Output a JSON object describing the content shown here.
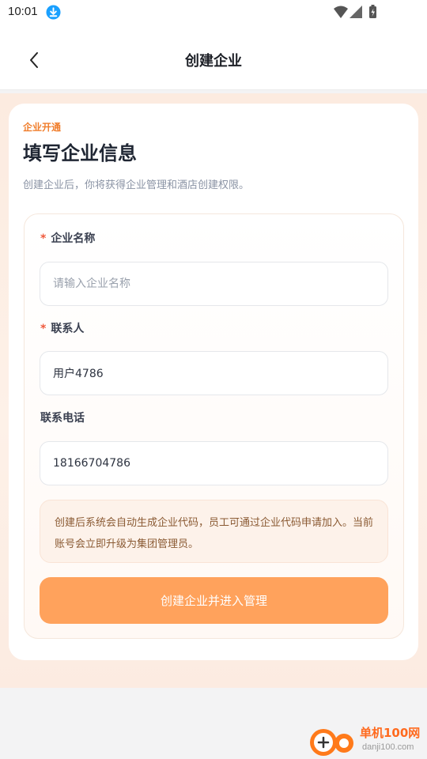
{
  "status_bar": {
    "time": "10:01"
  },
  "header": {
    "title": "创建企业"
  },
  "intro": {
    "kicker": "企业开通",
    "title": "填写企业信息",
    "subtitle": "创建企业后，你将获得企业管理和酒店创建权限。"
  },
  "form": {
    "company_name": {
      "label": "企业名称",
      "required_mark": "*",
      "value": "",
      "placeholder": "请输入企业名称"
    },
    "contact": {
      "label": "联系人",
      "required_mark": "*",
      "value": "用户4786"
    },
    "phone": {
      "label": "联系电话",
      "value": "18166704786"
    }
  },
  "notice": {
    "text": "创建后系统会自动生成企业代码，员工可通过企业代码申请加入。当前账号会立即升级为集团管理员。"
  },
  "submit": {
    "label": "创建企业并进入管理"
  },
  "watermark": {
    "brand": "单机100网",
    "site": "danji100.com"
  },
  "colors": {
    "accent": "#f07d2b",
    "button": "#ffa25c",
    "required": "#ef5a3c"
  }
}
